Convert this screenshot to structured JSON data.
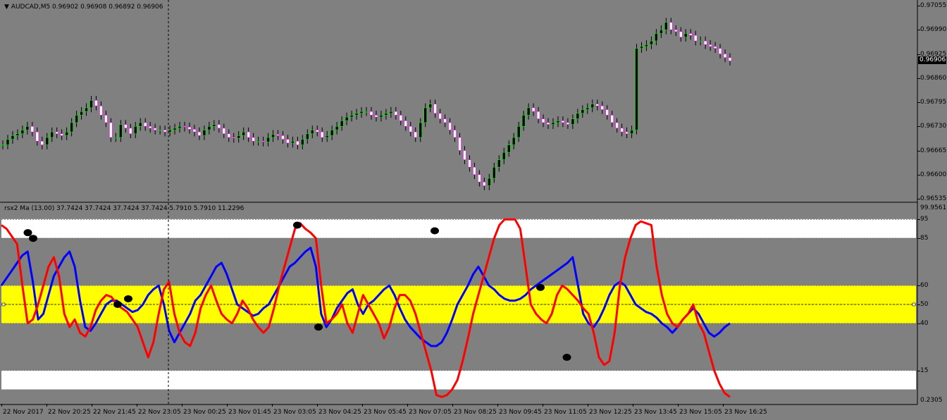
{
  "main": {
    "header": "AUDCAD,M5  0.96902 0.96908 0.96892 0.96906",
    "current_price": "0.96906",
    "price_scale": [
      "0.97055",
      "0.96990",
      "0.96925",
      "0.96860",
      "0.96795",
      "0.96730",
      "0.96665",
      "0.96600",
      "0.96535"
    ],
    "bull_color": "#00ff00",
    "bear_color": "#ff00ff",
    "candle_closes": [
      0.9668,
      0.96695,
      0.96705,
      0.9671,
      0.9672,
      0.9673,
      0.96715,
      0.9669,
      0.9668,
      0.967,
      0.96715,
      0.9671,
      0.96705,
      0.96715,
      0.9674,
      0.9676,
      0.9677,
      0.9678,
      0.968,
      0.96785,
      0.9676,
      0.9674,
      0.967,
      0.967,
      0.96735,
      0.96725,
      0.9671,
      0.9673,
      0.9674,
      0.9673,
      0.96725,
      0.9672,
      0.9672,
      0.96715,
      0.9672,
      0.96725,
      0.9673,
      0.96728,
      0.96722,
      0.96715,
      0.96705,
      0.9672,
      0.9673,
      0.96735,
      0.96725,
      0.9671,
      0.967,
      0.96698,
      0.96705,
      0.96715,
      0.967,
      0.9669,
      0.9669,
      0.96688,
      0.967,
      0.96708,
      0.96705,
      0.96695,
      0.96685,
      0.9669,
      0.9668,
      0.96695,
      0.9671,
      0.9672,
      0.96715,
      0.967,
      0.96705,
      0.9672,
      0.9673,
      0.96745,
      0.96755,
      0.9676,
      0.96765,
      0.9677,
      0.9677,
      0.9676,
      0.96755,
      0.9676,
      0.96765,
      0.9677,
      0.9676,
      0.96745,
      0.9673,
      0.96715,
      0.967,
      0.9674,
      0.9678,
      0.9679,
      0.96765,
      0.9675,
      0.9674,
      0.9672,
      0.967,
      0.96665,
      0.9664,
      0.9662,
      0.966,
      0.9658,
      0.9657,
      0.9659,
      0.9662,
      0.9664,
      0.9666,
      0.9668,
      0.967,
      0.9673,
      0.9676,
      0.9678,
      0.9677,
      0.9675,
      0.9674,
      0.96735,
      0.9674,
      0.96745,
      0.9674,
      0.96735,
      0.9675,
      0.96765,
      0.96775,
      0.9678,
      0.9679,
      0.96785,
      0.96775,
      0.9676,
      0.9674,
      0.96725,
      0.96715,
      0.9671,
      0.9672,
      0.9694,
      0.96945,
      0.9695,
      0.9696,
      0.9698,
      0.9699,
      0.9701,
      0.9699,
      0.96985,
      0.9697,
      0.9698,
      0.96975,
      0.9696,
      0.9696,
      0.9695,
      0.96945,
      0.9694,
      0.96925,
      0.96915,
      0.96906
    ]
  },
  "indicator": {
    "header": "rsx2 Ma (13.00) 37.7424 37.7424 37.7424 37.7424 5.7910 5.7910 11.2296",
    "scale_top": "99.9561",
    "scale_bottom": "0.2305",
    "levels": [
      "95",
      "85",
      "60",
      "50",
      "40",
      "15"
    ],
    "band_white_color": "#ffffff",
    "band_yellow_color": "#ffff00",
    "fast_line_color": "#ff0000",
    "slow_line_color": "#0000ff",
    "red_line": [
      92,
      90,
      86,
      82,
      60,
      40,
      42,
      50,
      60,
      70,
      75,
      65,
      45,
      38,
      42,
      35,
      33,
      38,
      47,
      52,
      55,
      54,
      50,
      48,
      46,
      42,
      38,
      30,
      22,
      30,
      45,
      58,
      62,
      45,
      35,
      30,
      28,
      35,
      48,
      55,
      60,
      52,
      45,
      42,
      40,
      45,
      52,
      48,
      42,
      38,
      35,
      38,
      48,
      60,
      70,
      80,
      90,
      93,
      90,
      88,
      85,
      60,
      40,
      42,
      45,
      50,
      40,
      35,
      45,
      55,
      50,
      45,
      40,
      32,
      38,
      48,
      55,
      55,
      52,
      45,
      35,
      25,
      15,
      2,
      1,
      2,
      5,
      10,
      20,
      32,
      45,
      55,
      65,
      75,
      85,
      92,
      95,
      95,
      95,
      90,
      70,
      50,
      45,
      42,
      40,
      45,
      55,
      60,
      58,
      55,
      52,
      48,
      45,
      35,
      22,
      18,
      20,
      35,
      60,
      75,
      85,
      92,
      94,
      93,
      92,
      70,
      55,
      45,
      40,
      38,
      42,
      45,
      50,
      40,
      35,
      25,
      15,
      8,
      3,
      1
    ],
    "blue_line": [
      60,
      64,
      68,
      72,
      76,
      78,
      62,
      42,
      45,
      55,
      65,
      70,
      75,
      78,
      70,
      52,
      38,
      36,
      40,
      45,
      50,
      52,
      52,
      50,
      48,
      46,
      47,
      50,
      55,
      58,
      60,
      50,
      36,
      30,
      35,
      40,
      45,
      52,
      55,
      60,
      65,
      70,
      72,
      66,
      58,
      50,
      48,
      46,
      44,
      45,
      48,
      50,
      55,
      60,
      65,
      70,
      72,
      75,
      78,
      80,
      70,
      45,
      38,
      42,
      48,
      52,
      56,
      58,
      50,
      45,
      50,
      52,
      55,
      58,
      60,
      55,
      48,
      42,
      38,
      35,
      32,
      30,
      28,
      28,
      30,
      35,
      42,
      50,
      55,
      60,
      66,
      70,
      65,
      60,
      58,
      55,
      53,
      52,
      52,
      53,
      55,
      58,
      60,
      62,
      64,
      66,
      68,
      70,
      72,
      75,
      60,
      45,
      40,
      38,
      42,
      48,
      55,
      60,
      62,
      60,
      55,
      50,
      48,
      46,
      45,
      43,
      40,
      38,
      35,
      38,
      42,
      45,
      48,
      45,
      40,
      35,
      33,
      35,
      38,
      40
    ],
    "dots": [
      {
        "x_index": 5,
        "y": 88
      },
      {
        "x_index": 6,
        "y": 85
      },
      {
        "x_index": 22,
        "y": 50
      },
      {
        "x_index": 24,
        "y": 53
      },
      {
        "x_index": 56,
        "y": 92
      },
      {
        "x_index": 60,
        "y": 38
      },
      {
        "x_index": 82,
        "y": 89
      },
      {
        "x_index": 102,
        "y": 59
      },
      {
        "x_index": 107,
        "y": 22
      }
    ]
  },
  "time_axis": {
    "labels": [
      "22 Nov 2017",
      "22 Nov 20:25",
      "22 Nov 21:45",
      "22 Nov 23:05",
      "23 Nov 00:25",
      "23 Nov 01:45",
      "23 Nov 03:05",
      "23 Nov 04:25",
      "23 Nov 05:45",
      "23 Nov 07:05",
      "23 Nov 08:25",
      "23 Nov 09:45",
      "23 Nov 11:05",
      "23 Nov 12:25",
      "23 Nov 13:45",
      "23 Nov 15:05",
      "23 Nov 16:25"
    ]
  }
}
